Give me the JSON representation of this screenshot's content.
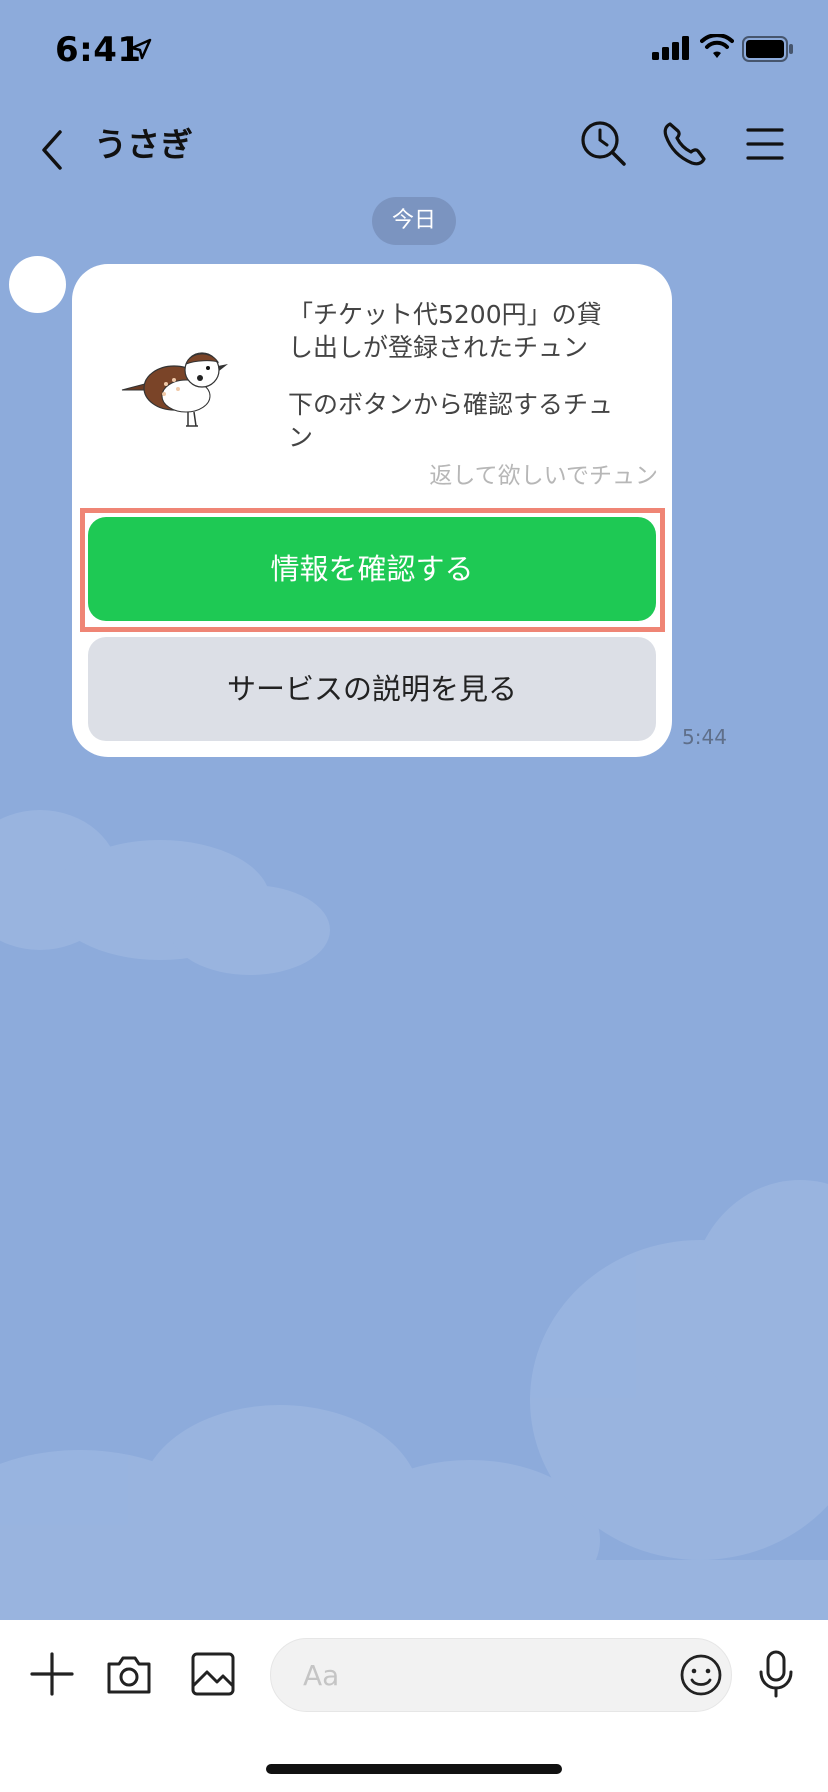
{
  "status_bar": {
    "time": "6:41"
  },
  "header": {
    "title": "うさぎ"
  },
  "date_divider": "今日",
  "message": {
    "line1": "「チケット代5200円」の貸",
    "line2": "し出しが登録されたチュン",
    "line3": "下のボタンから確認するチュ",
    "line4": "ン",
    "faint": "返して欲しいでチュン",
    "primary_button": "情報を確認する",
    "secondary_button": "サービスの説明を見る",
    "time": "5:44"
  },
  "input": {
    "placeholder": "Aa"
  },
  "colors": {
    "background": "#8dabdb",
    "primary_button": "#1ec954",
    "secondary_button": "#dcdfe6",
    "highlight": "#ef8575"
  },
  "icons": {
    "header": [
      "back-chevron-icon",
      "search-history-icon",
      "phone-icon",
      "menu-icon"
    ],
    "input_bar": [
      "plus-icon",
      "camera-icon",
      "image-icon",
      "emoji-icon",
      "microphone-icon"
    ]
  }
}
